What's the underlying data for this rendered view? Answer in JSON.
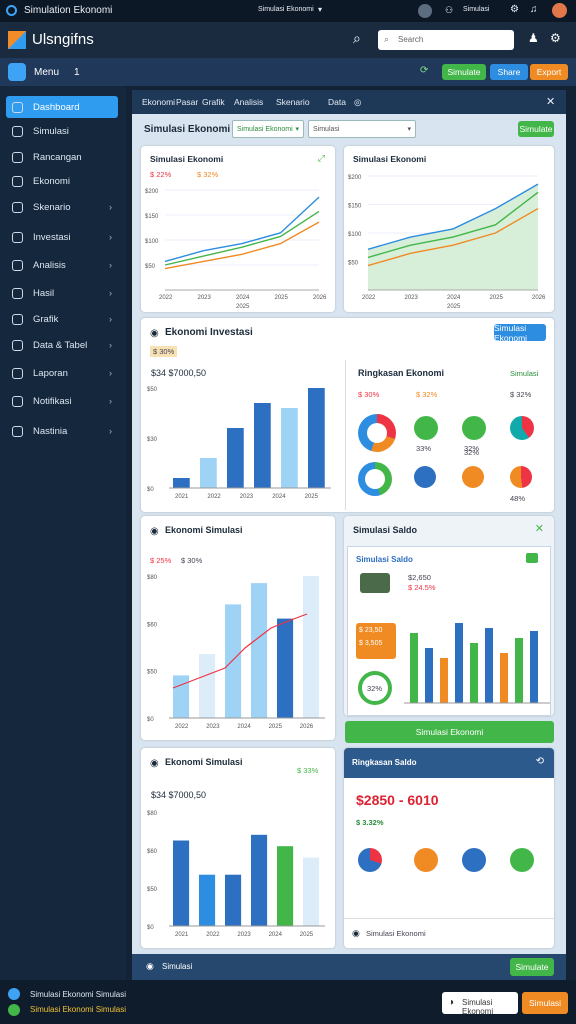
{
  "window": {
    "title": "Simulation Ekonomi",
    "user_label": "Simulasi Ekonomi",
    "right_label": "Simulasi"
  },
  "appbar": {
    "title": "Ulsngifns",
    "search_placeholder": "Search"
  },
  "toolbar": {
    "menu_label": "Menu",
    "count": "1",
    "btn_green": "Simulate",
    "btn_blue": "Share",
    "btn_orange": "Export"
  },
  "sidebar": {
    "items": [
      {
        "label": "Dashboard"
      },
      {
        "label": "Simulasi"
      },
      {
        "label": "Rancangan"
      },
      {
        "label": "Ekonomi"
      },
      {
        "label": "Skenario"
      },
      {
        "label": "Investasi"
      },
      {
        "label": "Analisis"
      },
      {
        "label": "Hasil"
      },
      {
        "label": "Grafik"
      },
      {
        "label": "Data & Tabel"
      },
      {
        "label": "Laporan"
      },
      {
        "label": "Notifikasi"
      },
      {
        "label": "Nastinia"
      }
    ]
  },
  "tabs": [
    {
      "label": "Ekonomi"
    },
    {
      "label": "Pasar"
    },
    {
      "label": "Grafik"
    },
    {
      "label": "Analisis"
    },
    {
      "label": "Skenario"
    },
    {
      "label": "Data"
    }
  ],
  "header": {
    "title": "Simulasi Ekonomi",
    "dropdown1": "Simulasi Ekonomi",
    "dropdown2": "Simulasi",
    "action": "Simulate"
  },
  "line_chart_1": {
    "title": "Simulasi Ekonomi",
    "legend1": "$ 22%",
    "legend2": "$ 32%",
    "xlabel": "2025",
    "chart_data": {
      "type": "line",
      "x": [
        "2022",
        "2023",
        "2024",
        "2025",
        "2026"
      ],
      "series": [
        {
          "values": [
            80,
            110,
            130,
            160,
            260
          ]
        },
        {
          "values": [
            70,
            95,
            120,
            150,
            220
          ]
        },
        {
          "values": [
            60,
            80,
            100,
            130,
            190
          ]
        }
      ],
      "yticks": [
        "$200",
        "$150",
        "$100",
        "$50"
      ]
    }
  },
  "line_chart_2": {
    "title": "Simulasi Ekonomi",
    "xlabel": "2025",
    "chart_data": {
      "type": "area",
      "x": [
        "2022",
        "2023",
        "2024",
        "2025",
        "2026"
      ],
      "series": [
        {
          "values": [
            100,
            130,
            150,
            200,
            260
          ]
        },
        {
          "values": [
            80,
            110,
            130,
            160,
            240
          ]
        },
        {
          "values": [
            60,
            90,
            110,
            140,
            200
          ]
        }
      ],
      "yticks": [
        "$200",
        "$150",
        "$100",
        "$50"
      ]
    }
  },
  "bar_chart_1": {
    "title": "Ekonomi Investasi",
    "badge": "$ 30%",
    "stat": "$ 30.00%",
    "stat_label": "$34 $7000,50",
    "chart_data": {
      "type": "bar",
      "categories": [
        "2021",
        "2022",
        "2023",
        "2024",
        "2025"
      ],
      "values": [
        10,
        30,
        60,
        85,
        80,
        100
      ],
      "yticks": [
        "$50",
        "$30",
        "$0"
      ]
    }
  },
  "donut_panel": {
    "title": "Ringkasan Ekonomi",
    "subtitle": "Simulasi",
    "legend": [
      "$ 30%",
      "$ 32%",
      "$ 32%"
    ],
    "values": [
      "33%",
      "32%",
      "32%",
      "48%"
    ]
  },
  "bar_chart_2": {
    "title": "Ekonomi Simulasi",
    "legend": "$ 25%",
    "legend2": "$ 30%",
    "chart_data": {
      "type": "bar",
      "categories": [
        "2022",
        "2023",
        "2024",
        "2025",
        "2026"
      ],
      "values": [
        30,
        45,
        80,
        95,
        70,
        100
      ],
      "yticks": [
        "$80",
        "$60",
        "$50",
        "$0"
      ]
    }
  },
  "right_panel": {
    "title": "Simulasi Saldo",
    "sub": "Simulasi Saldo",
    "big1": "$2,650",
    "big2": "$ 24.5%",
    "price1": "$ 23,50",
    "price2": "$ 3,505",
    "gauge": "32%",
    "btn": "Simulasi Ekonomi"
  },
  "bar_chart_3": {
    "title": "Ekonomi Simulasi",
    "badge": "$ 33%",
    "stat": "$34 $7000,50",
    "chart_data": {
      "type": "bar",
      "categories": [
        "2021",
        "2022",
        "2023",
        "2024",
        "2025"
      ],
      "values": [
        75,
        45,
        45,
        80,
        70,
        60
      ],
      "yticks": [
        "$80",
        "$60",
        "$50",
        "$0"
      ]
    }
  },
  "summary_panel": {
    "title": "Ringkasan Saldo",
    "big": "$2850 - 6010",
    "growth": "$ 3.32%",
    "legend": "Simulasi Ekonomi"
  },
  "footer": {
    "label": "Simulasi",
    "btn": "Simulate"
  },
  "status": {
    "line1": "Simulasi Ekonomi Simulasi",
    "line2": "Simulasi Ekonomi Simulasi",
    "select": "Simulasi Ekonomi",
    "btn": "Simulasi"
  }
}
